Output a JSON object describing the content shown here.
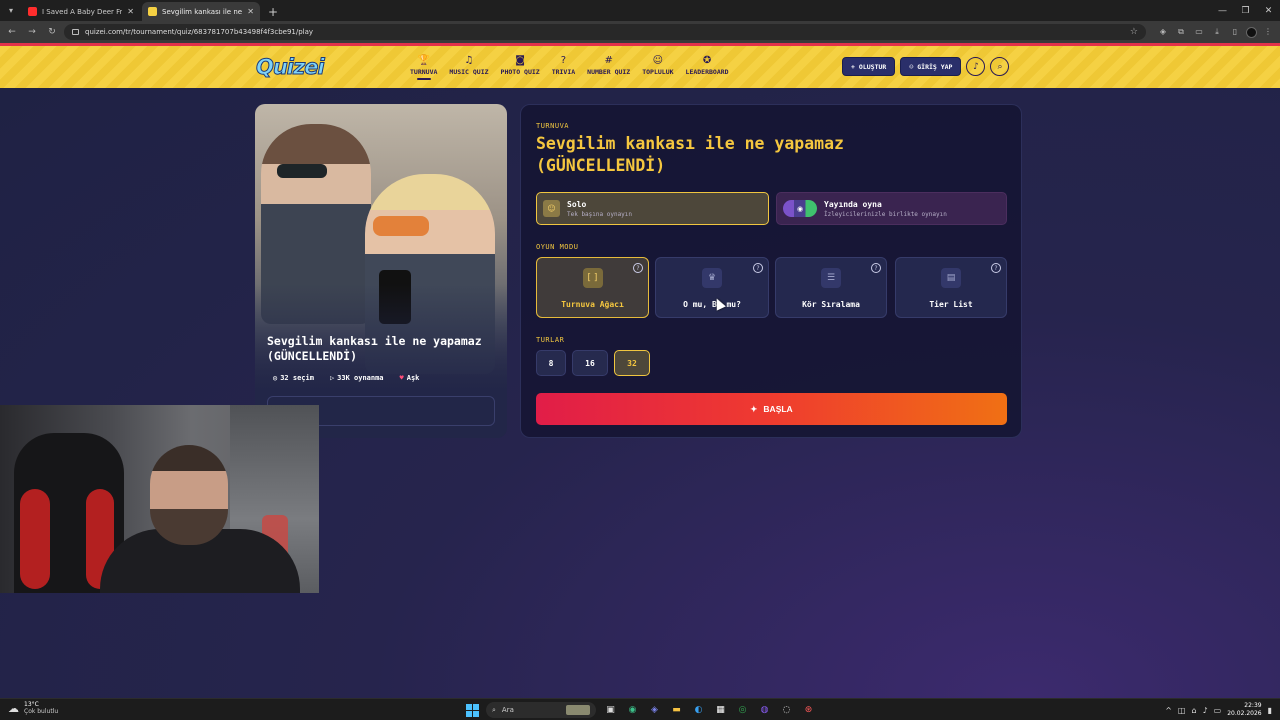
{
  "browser": {
    "tabs": [
      {
        "title": "I Saved A Baby Deer From A Wi",
        "favicon_color": "#ff2d2d",
        "active": false
      },
      {
        "title": "Sevgilim kankası ile ne yapamaz",
        "favicon_color": "#f5d143",
        "active": true
      }
    ],
    "url": "quizei.com/tr/tournament/quiz/683781707b43498f4f3cbe91/play"
  },
  "header": {
    "logo": "Quizei",
    "nav": [
      {
        "label": "TURNUVA",
        "icon": "trophy-icon",
        "glyph": "🏆",
        "active": true
      },
      {
        "label": "MUSIC QUIZ",
        "icon": "music-icon",
        "glyph": "♫"
      },
      {
        "label": "PHOTO QUIZ",
        "icon": "camera-icon",
        "glyph": "◙"
      },
      {
        "label": "TRIVIA",
        "icon": "chat-icon",
        "glyph": "?"
      },
      {
        "label": "NUMBER QUIZ",
        "icon": "hash-icon",
        "glyph": "#"
      },
      {
        "label": "TOPLULUK",
        "icon": "users-icon",
        "glyph": "☺"
      },
      {
        "label": "LEADERBOARD",
        "icon": "medal-icon",
        "glyph": "✪"
      }
    ],
    "create_label": "OLUŞTUR",
    "login_label": "GİRİŞ YAP"
  },
  "quiz_card": {
    "title": "Sevgilim kankası ile ne yapamaz (GÜNCELLENDİ)",
    "choices": "32 seçim",
    "plays": "33K oynanma",
    "category": "Aşk"
  },
  "panel": {
    "eyebrow": "TURNUVA",
    "title": "Sevgilim kankası ile ne yapamaz (GÜNCELLENDİ)",
    "modes": {
      "solo": {
        "title": "Solo",
        "subtitle": "Tek başına oynayın"
      },
      "live": {
        "title": "Yayında oyna",
        "subtitle": "İzleyicilerinizle birlikte oynayın"
      }
    },
    "game_mode_label": "OYUN MODU",
    "game_modes": [
      {
        "label": "Turnuva Ağacı",
        "icon": "bracket-icon",
        "glyph": "[ ]",
        "active": true
      },
      {
        "label": "O mu, Bu mu?",
        "icon": "crown-icon",
        "glyph": "♛",
        "active": false
      },
      {
        "label": "Kör Sıralama",
        "icon": "list-icon",
        "glyph": "☰",
        "active": false
      },
      {
        "label": "Tier List",
        "icon": "tiers-icon",
        "glyph": "▤",
        "active": false
      }
    ],
    "rounds_label": "TURLAR",
    "rounds": [
      {
        "label": "8",
        "active": false
      },
      {
        "label": "16",
        "active": false
      },
      {
        "label": "32",
        "active": true
      }
    ],
    "start_label": "BAŞLA"
  },
  "taskbar": {
    "temperature": "13°C",
    "weather": "Çok bulutlu",
    "search_placeholder": "Ara",
    "time": "22:39",
    "date": "20.02.2026"
  }
}
